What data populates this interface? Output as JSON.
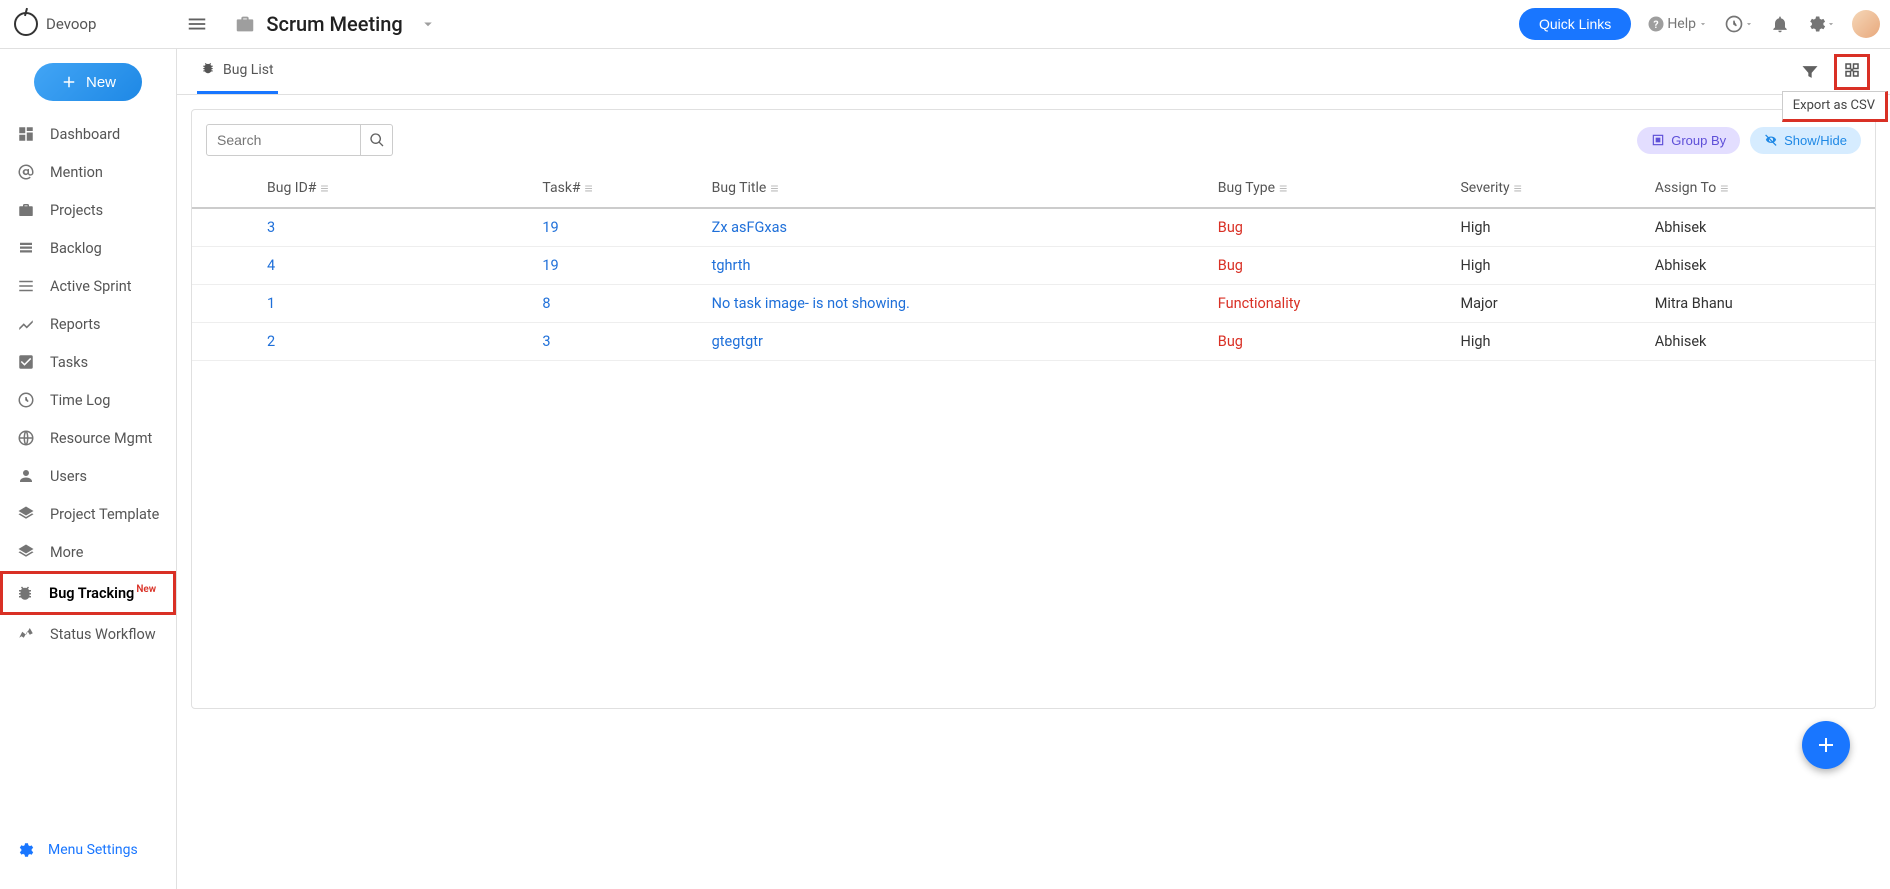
{
  "header": {
    "logo_text": "Devoop",
    "project_title": "Scrum Meeting",
    "quick_links_label": "Quick Links",
    "help_label": "Help"
  },
  "sidebar": {
    "new_label": "New",
    "items": [
      {
        "label": "Dashboard"
      },
      {
        "label": "Mention"
      },
      {
        "label": "Projects"
      },
      {
        "label": "Backlog"
      },
      {
        "label": "Active Sprint"
      },
      {
        "label": "Reports"
      },
      {
        "label": "Tasks"
      },
      {
        "label": "Time Log"
      },
      {
        "label": "Resource Mgmt"
      },
      {
        "label": "Users"
      },
      {
        "label": "Project Template"
      },
      {
        "label": "More"
      },
      {
        "label": "Bug Tracking",
        "badge": "New"
      },
      {
        "label": "Status Workflow"
      }
    ],
    "menu_settings_label": "Menu Settings"
  },
  "tabs": {
    "active_tab_label": "Bug List",
    "export_tooltip": "Export as CSV"
  },
  "toolbar": {
    "search_placeholder": "Search",
    "group_by_label": "Group By",
    "show_hide_label": "Show/Hide"
  },
  "table": {
    "columns": [
      "Bug ID#",
      "Task#",
      "Bug Title",
      "Bug Type",
      "Severity",
      "Assign To"
    ],
    "rows": [
      {
        "bug_id": "3",
        "task": "19",
        "title": "Zx asFGxas",
        "type": "Bug",
        "severity": "High",
        "assign": "Abhisek"
      },
      {
        "bug_id": "4",
        "task": "19",
        "title": "tghrth",
        "type": "Bug",
        "severity": "High",
        "assign": "Abhisek"
      },
      {
        "bug_id": "1",
        "task": "8",
        "title": "No task image- is not showing.",
        "type": "Functionality",
        "severity": "Major",
        "assign": "Mitra Bhanu"
      },
      {
        "bug_id": "2",
        "task": "3",
        "title": "gtegtgtr",
        "type": "Bug",
        "severity": "High",
        "assign": "Abhisek"
      }
    ]
  }
}
